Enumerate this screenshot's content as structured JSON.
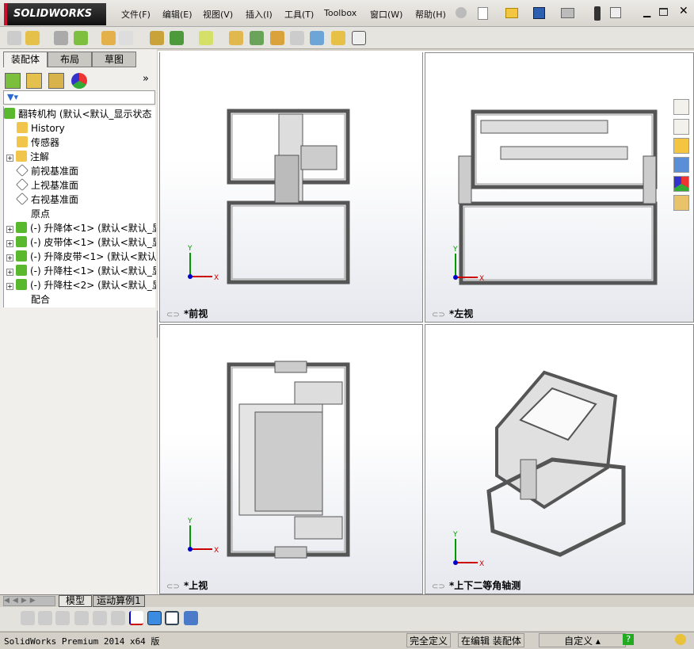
{
  "app": {
    "logo": "SOLIDWORKS"
  },
  "menu": [
    "文件(F)",
    "编辑(E)",
    "视图(V)",
    "插入(I)",
    "工具(T)",
    "Toolbox",
    "窗口(W)",
    "帮助(H)"
  ],
  "left_tabs": [
    "装配体",
    "布局",
    "草图"
  ],
  "tree": {
    "root": "翻转机构  (默认<默认_显示状态",
    "items": [
      {
        "label": "History",
        "icon": "history-folder-icon",
        "expand": false
      },
      {
        "label": "传感器",
        "icon": "sensor-folder-icon",
        "expand": false
      },
      {
        "label": "注解",
        "icon": "annotation-folder-icon",
        "expand": true
      },
      {
        "label": "前视基准面",
        "icon": "plane-icon",
        "expand": false
      },
      {
        "label": "上视基准面",
        "icon": "plane-icon",
        "expand": false
      },
      {
        "label": "右视基准面",
        "icon": "plane-icon",
        "expand": false
      },
      {
        "label": "原点",
        "icon": "origin-icon",
        "expand": false
      },
      {
        "label": "(-) 升降体<1> (默认<默认_显",
        "icon": "part-icon",
        "expand": true
      },
      {
        "label": "(-) 皮带体<1> (默认<默认_显",
        "icon": "part-icon",
        "expand": true
      },
      {
        "label": "(-) 升降皮带<1> (默认<默认",
        "icon": "part-icon",
        "expand": true
      },
      {
        "label": "(-) 升降柱<1> (默认<默认_显",
        "icon": "part-icon",
        "expand": true
      },
      {
        "label": "(-) 升降柱<2> (默认<默认_显",
        "icon": "part-icon",
        "expand": true
      },
      {
        "label": "配合",
        "icon": "mates-icon",
        "expand": false
      }
    ]
  },
  "viewports": [
    {
      "label": "*前视"
    },
    {
      "label": "*左视"
    },
    {
      "label": "*上视"
    },
    {
      "label": "*上下二等角轴测"
    }
  ],
  "bottom_tabs": [
    "模型",
    "运动算例1"
  ],
  "status": {
    "product": "SolidWorks Premium 2014 x64 版",
    "state": "完全定义",
    "mode": "在编辑 装配体",
    "units": "自定义"
  },
  "colors": {
    "accent": "#c8102e",
    "axis_x": "#cc0000",
    "axis_y": "#009900",
    "axis_z": "#0000cc"
  }
}
